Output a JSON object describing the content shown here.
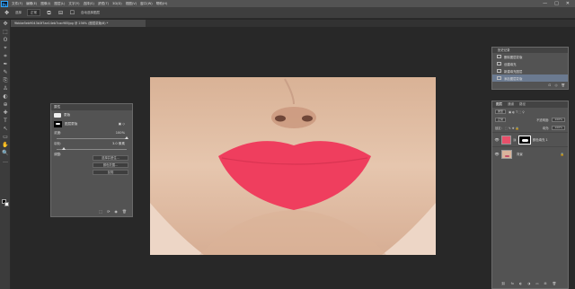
{
  "app": {
    "logo": "Ps"
  },
  "menubar": {
    "items": [
      "文件(F)",
      "编辑(E)",
      "图像(I)",
      "图层(L)",
      "文字(Y)",
      "选择(S)",
      "滤镜(T)",
      "3D(D)",
      "视图(V)",
      "窗口(W)",
      "帮助(H)"
    ],
    "window_controls": [
      "—",
      "□",
      "✕"
    ]
  },
  "options": {
    "mode_label": "选择",
    "mode_value": "正常",
    "icons": [
      "move-icon",
      "transform-icon",
      "align-icon"
    ],
    "check_label": "自动选择图层"
  },
  "document": {
    "tab_title": "9bbbe5eb9043b3f7ae14eb7cac985jpg @ 236% (图层蒙版/8) *"
  },
  "tools": [
    "✥",
    "⬚",
    "ʘ",
    "⌖",
    "⌗",
    "✒",
    "✎",
    "⎘",
    "♙",
    "◐",
    "⊕",
    "✚",
    "T",
    "↖",
    "▭",
    "✋",
    "🔍",
    "…"
  ],
  "properties": {
    "title": "属性",
    "mask_label": "蒙版",
    "layer_mask_label": "图层蒙版",
    "density_label": "浓度:",
    "density_value": "100%",
    "density_fraction": 1.0,
    "feather_label": "羽化:",
    "feather_value": "3.0 像素",
    "feather_fraction": 0.1,
    "refine_label": "调整:",
    "buttons": [
      "选择并遮住...",
      "颜色范围...",
      "反相"
    ],
    "footer_icons": [
      "⬚",
      "⟳",
      "◉",
      "🗑"
    ]
  },
  "history": {
    "title": "历史记录",
    "items": [
      "删除图层蒙版",
      "创建填充",
      "新建填充图层",
      "添加图层蒙版"
    ],
    "selected_index": 3,
    "footer_icons": [
      "⊡",
      "◎",
      "🗑"
    ]
  },
  "layers": {
    "tabs": [
      "图层",
      "通道",
      "路径"
    ],
    "kind_label": "类型",
    "blend_mode": "正常",
    "opacity_label": "不透明度:",
    "opacity_value": "100%",
    "lock_label": "锁定:",
    "fill_label": "填充:",
    "fill_value": "100%",
    "rows": [
      {
        "name": "颜色填充 1",
        "visible": true
      },
      {
        "name": "背景",
        "visible": true
      }
    ],
    "footer_icons": [
      "⛓",
      "fx",
      "◐",
      "◑",
      "▭",
      "⊞",
      "🗑"
    ]
  },
  "colors": {
    "lip": "#ef3e5e",
    "skin": "#e2c0a8",
    "panel": "#535353"
  }
}
